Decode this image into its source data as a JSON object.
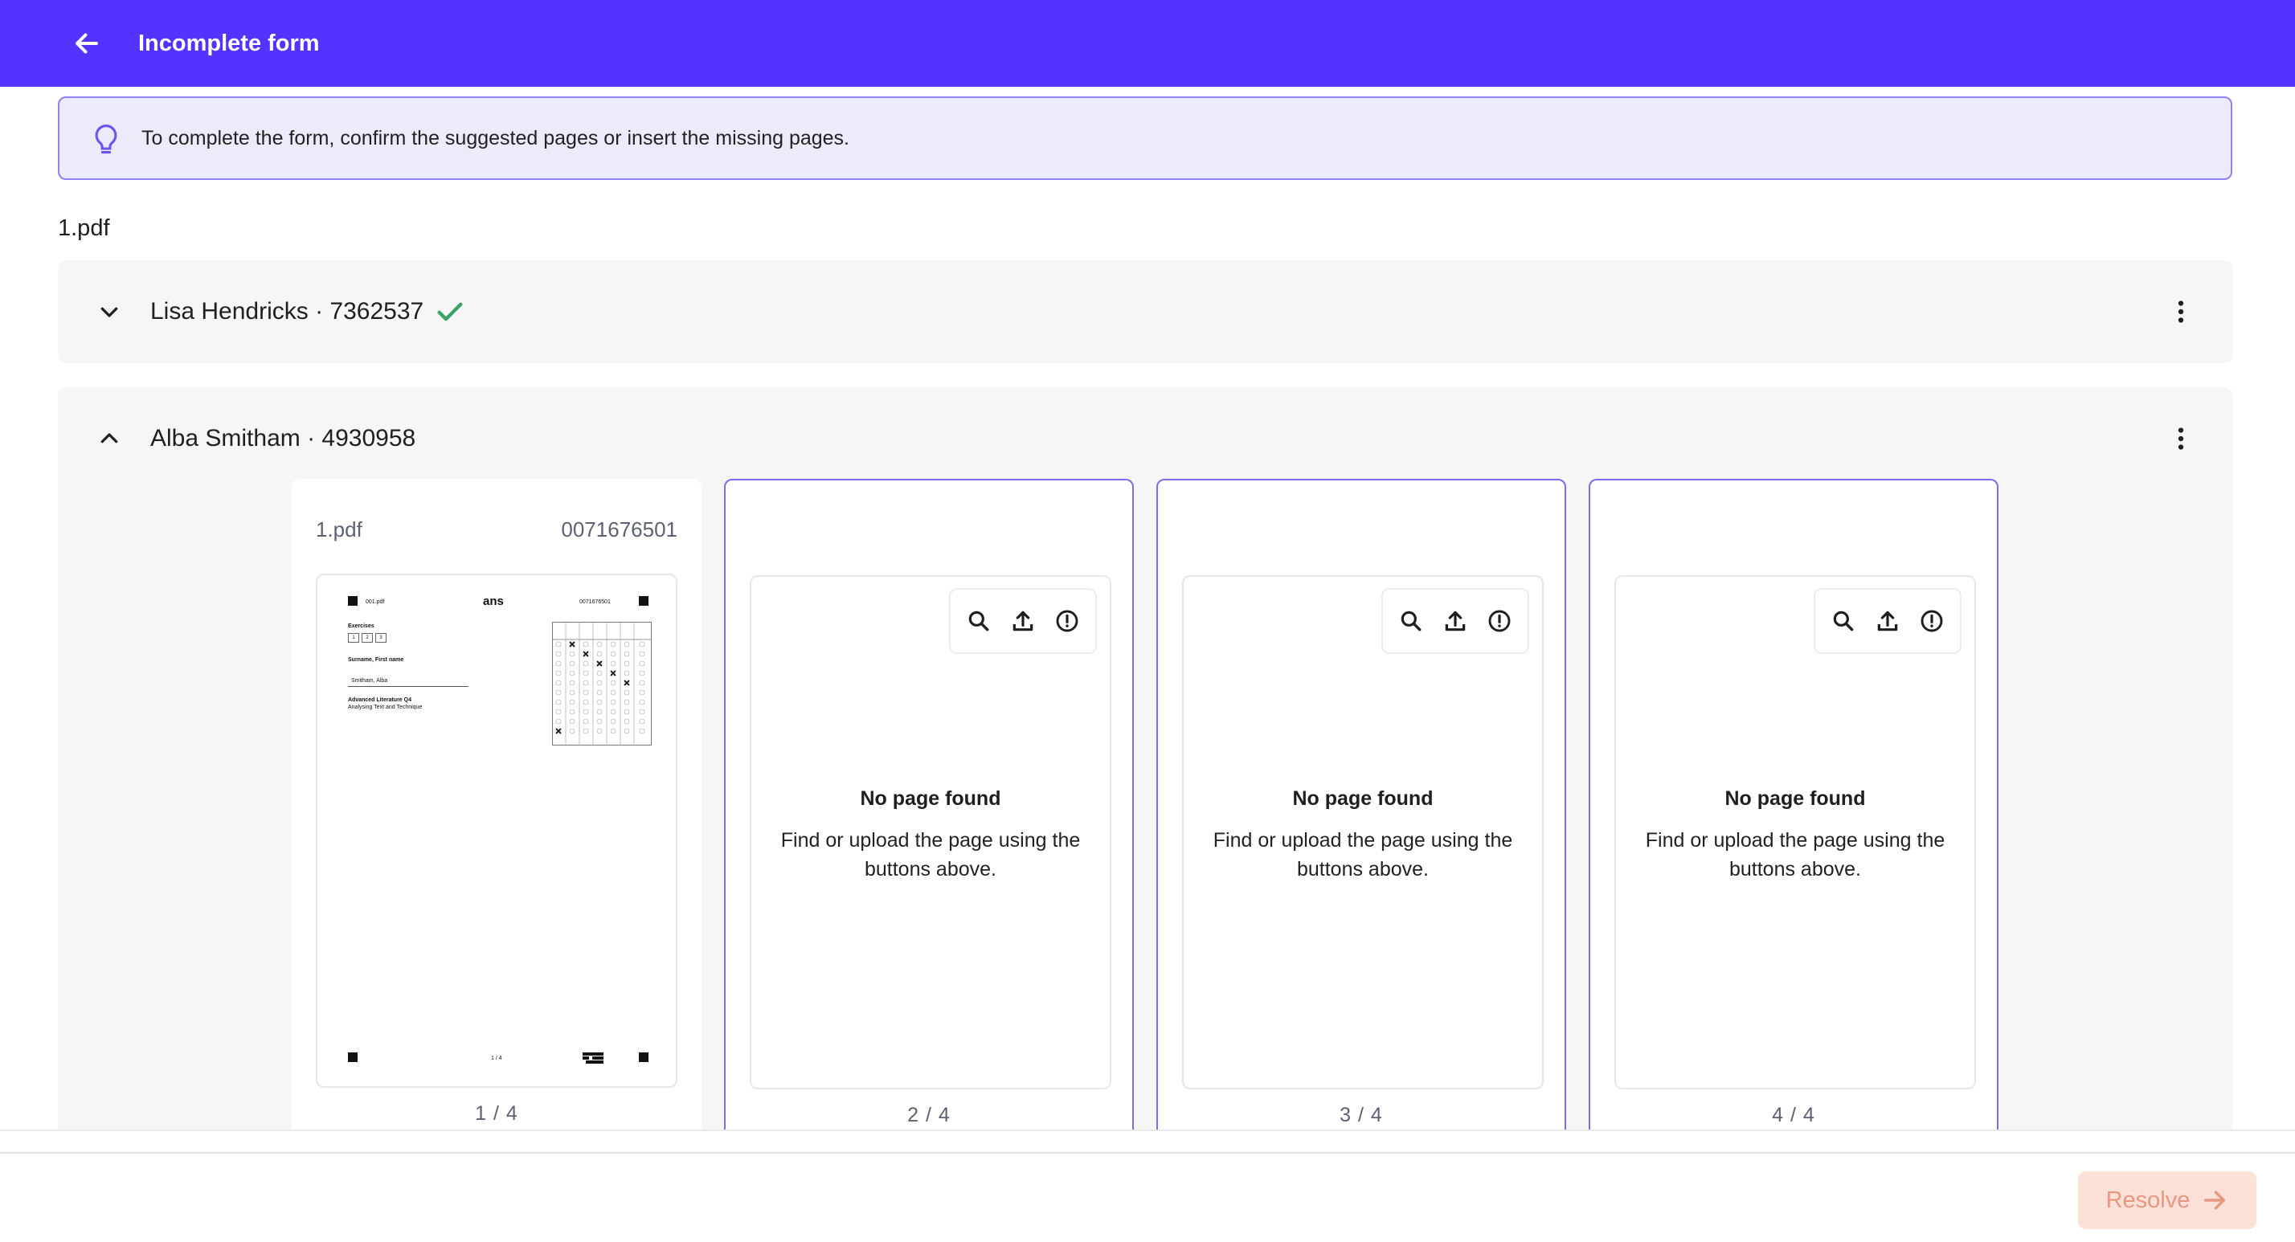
{
  "header": {
    "title": "Incomplete form",
    "back_icon": "arrow-left-icon",
    "bg_color": "#5533ff"
  },
  "tip": {
    "icon": "lightbulb-icon",
    "text": "To complete the form, confirm the suggested pages or insert the missing pages."
  },
  "file": {
    "name": "1.pdf"
  },
  "students": [
    {
      "name": "Lisa Hendricks · 7362537",
      "expanded": false,
      "status_icon": "check-icon",
      "status_color": "#3aa464"
    },
    {
      "name": "Alba Smitham · 4930958",
      "expanded": true
    }
  ],
  "pages": [
    {
      "file": "1.pdf",
      "code": "0071676501",
      "count": "1 / 4",
      "preview": {
        "file_label": "001.pdf",
        "logo": "ans",
        "code": "0071676501",
        "section": "Exercises",
        "boxes": [
          "1",
          "2",
          "3"
        ],
        "name_label": "Surname, First name",
        "name_value": "Smitham, Alba",
        "course": "Advanced Literature Q4",
        "subtitle": "Analysing Text and Technique",
        "footer": "1 / 4"
      }
    },
    {
      "count": "2 / 4",
      "title": "No page found",
      "desc": "Find or upload the page using the buttons above."
    },
    {
      "count": "3 / 4",
      "title": "No page found",
      "desc": "Find or upload the page using the buttons above."
    },
    {
      "count": "4 / 4",
      "title": "No page found",
      "desc": "Find or upload the page using the buttons above."
    }
  ],
  "footer": {
    "resolve_label": "Resolve",
    "resolve_icon": "arrow-right-icon"
  }
}
